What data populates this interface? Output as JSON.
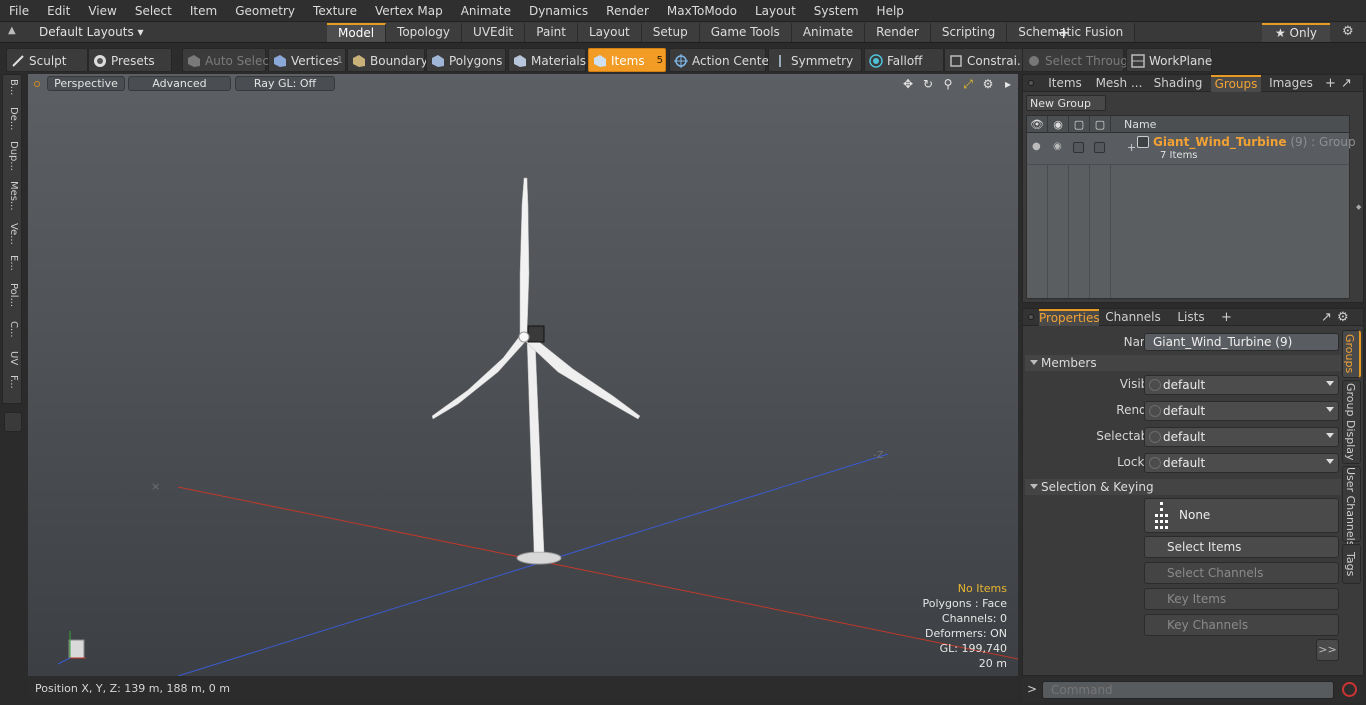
{
  "menubar": [
    "File",
    "Edit",
    "View",
    "Select",
    "Item",
    "Geometry",
    "Texture",
    "Vertex Map",
    "Animate",
    "Dynamics",
    "Render",
    "MaxToModo",
    "Layout",
    "System",
    "Help"
  ],
  "layouts": {
    "label": "Default Layouts ▾"
  },
  "layout_tabs": [
    "Model",
    "Topology",
    "UVEdit",
    "Paint",
    "Layout",
    "Setup",
    "Game Tools",
    "Animate",
    "Render",
    "Scripting",
    "Schematic Fusion"
  ],
  "active_tab": "Model",
  "only": {
    "label": "★  Only"
  },
  "toolbar": {
    "sculpt": "Sculpt",
    "presets": "Presets",
    "auto_select": "Auto Select",
    "vertices": "Vertices",
    "vertices_count": "1",
    "boundary": "Boundary",
    "polygons": "Polygons",
    "materials": "Materials",
    "items": "Items",
    "items_count": "5",
    "action_center": "Action Center",
    "symmetry": "Symmetry",
    "falloff": "Falloff",
    "constraints": "Constrai...",
    "select_through": "Select Through",
    "workplane": "WorkPlane"
  },
  "left_strip": [
    "B...",
    "De...",
    "Dup...",
    "Mes...",
    "Ve...",
    "E...",
    "Pol...",
    "C...",
    "UV",
    "F..."
  ],
  "viewport": {
    "perspective": "Perspective",
    "advanced": "Advanced",
    "raygl": "Ray GL: Off",
    "axis_label": "-Z",
    "info": {
      "items": "No Items",
      "polygons": "Polygons : Face",
      "channels": "Channels: 0",
      "deformers": "Deformers: ON",
      "gl": "GL: 199,740",
      "scale": "20 m"
    }
  },
  "statusbar": {
    "position": "Position X, Y, Z:   139 m, 188 m, 0 m"
  },
  "groups_panel": {
    "tabs": [
      "Items",
      "Mesh ...",
      "Shading",
      "Groups",
      "Images"
    ],
    "active": "Groups",
    "new_group": "New Group",
    "col_name": "Name",
    "group": {
      "name": "Giant_Wind_Turbine",
      "suffix": " (9) : Group",
      "count": "7 Items"
    }
  },
  "props_panel": {
    "tabs": [
      "Properties",
      "Channels",
      "Lists"
    ],
    "active": "Properties",
    "name_label": "Name",
    "name_value": "Giant_Wind_Turbine (9)",
    "members": "Members",
    "visible_label": "Visible",
    "render_label": "Render",
    "selectable_label": "Selectable",
    "locked_label": "Locked",
    "default": "default",
    "selection_keying": "Selection & Keying",
    "none": "None",
    "select_items": "Select Items",
    "select_channels": "Select Channels",
    "key_items": "Key Items",
    "key_channels": "Key Channels",
    "more": ">>"
  },
  "side_tabs": [
    "Groups",
    "Group Display",
    "User Channels",
    "Tags"
  ],
  "command": {
    "placeholder": "Command"
  },
  "colors": {
    "accent": "#f29b25",
    "x_axis": "#c0392b",
    "z_axis": "#3a5bd0"
  }
}
